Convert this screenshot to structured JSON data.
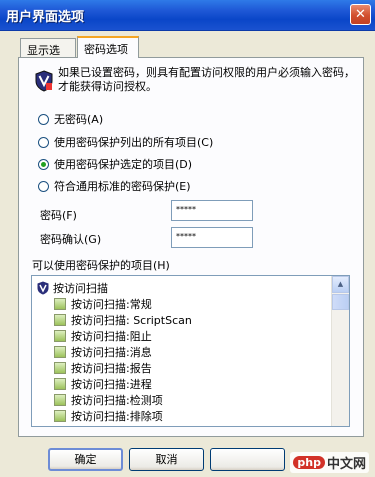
{
  "window": {
    "title": "用户界面选项",
    "close_glyph": "✕"
  },
  "tabs": [
    {
      "label": "显示选项",
      "active": false
    },
    {
      "label": "密码选项",
      "active": true
    }
  ],
  "description": "如果已设置密码，则具有配置访问权限的用户必须输入密码，才能获得访问授权。",
  "radios": [
    {
      "label": "无密码(A)",
      "checked": false
    },
    {
      "label": "使用密码保护列出的所有项目(C)",
      "checked": false
    },
    {
      "label": "使用密码保护选定的项目(D)",
      "checked": true
    },
    {
      "label": "符合通用标准的密码保护(E)",
      "checked": false
    }
  ],
  "fields": {
    "password_label": "密码(F)",
    "password_value": "*****",
    "confirm_label": "密码确认(G)",
    "confirm_value": "*****"
  },
  "list": {
    "label": "可以使用密码保护的项目(H)",
    "root": "按访问扫描",
    "items": [
      "按访问扫描:常规",
      "按访问扫描: ScriptScan",
      "按访问扫描:阻止",
      "按访问扫描:消息",
      "按访问扫描:报告",
      "按访问扫描:进程",
      "按访问扫描:检测项",
      "按访问扫描:排除项"
    ]
  },
  "buttons": {
    "ok": "确定",
    "cancel": "取消"
  },
  "watermark": {
    "logo": "php",
    "text": "中文网"
  },
  "colors": {
    "title_bar": "#0A46C8",
    "dialog_bg": "#ECE9D8",
    "active_tab_accent": "#F5A623"
  },
  "icons": {
    "root": "shield-icon",
    "items": "checkbox-icon",
    "close": "close-icon"
  }
}
